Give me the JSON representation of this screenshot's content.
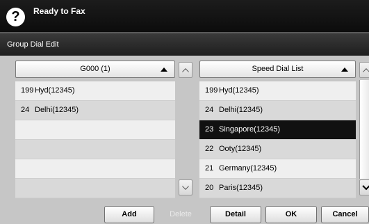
{
  "status": {
    "text": "Ready to Fax",
    "help_icon": "?"
  },
  "title": "Group Dial Edit",
  "left_list": {
    "header": "G000 (1)",
    "rows": [
      {
        "num": "199",
        "name": "Hyd(12345)"
      },
      {
        "num": "24",
        "name": "Delhi(12345)"
      },
      {
        "num": "",
        "name": ""
      },
      {
        "num": "",
        "name": ""
      },
      {
        "num": "",
        "name": ""
      },
      {
        "num": "",
        "name": ""
      }
    ]
  },
  "right_list": {
    "header": "Speed Dial List",
    "selected_index": 2,
    "rows": [
      {
        "num": "199",
        "name": "Hyd(12345)"
      },
      {
        "num": "24",
        "name": "Delhi(12345)"
      },
      {
        "num": "23",
        "name": "Singapore(12345)"
      },
      {
        "num": "22",
        "name": "Ooty(12345)"
      },
      {
        "num": "21",
        "name": "Germany(12345)"
      },
      {
        "num": "20",
        "name": "Paris(12345)"
      }
    ]
  },
  "buttons": {
    "add": "Add",
    "delete": "Delete",
    "detail": "Detail",
    "ok": "OK",
    "cancel": "Cancel"
  }
}
